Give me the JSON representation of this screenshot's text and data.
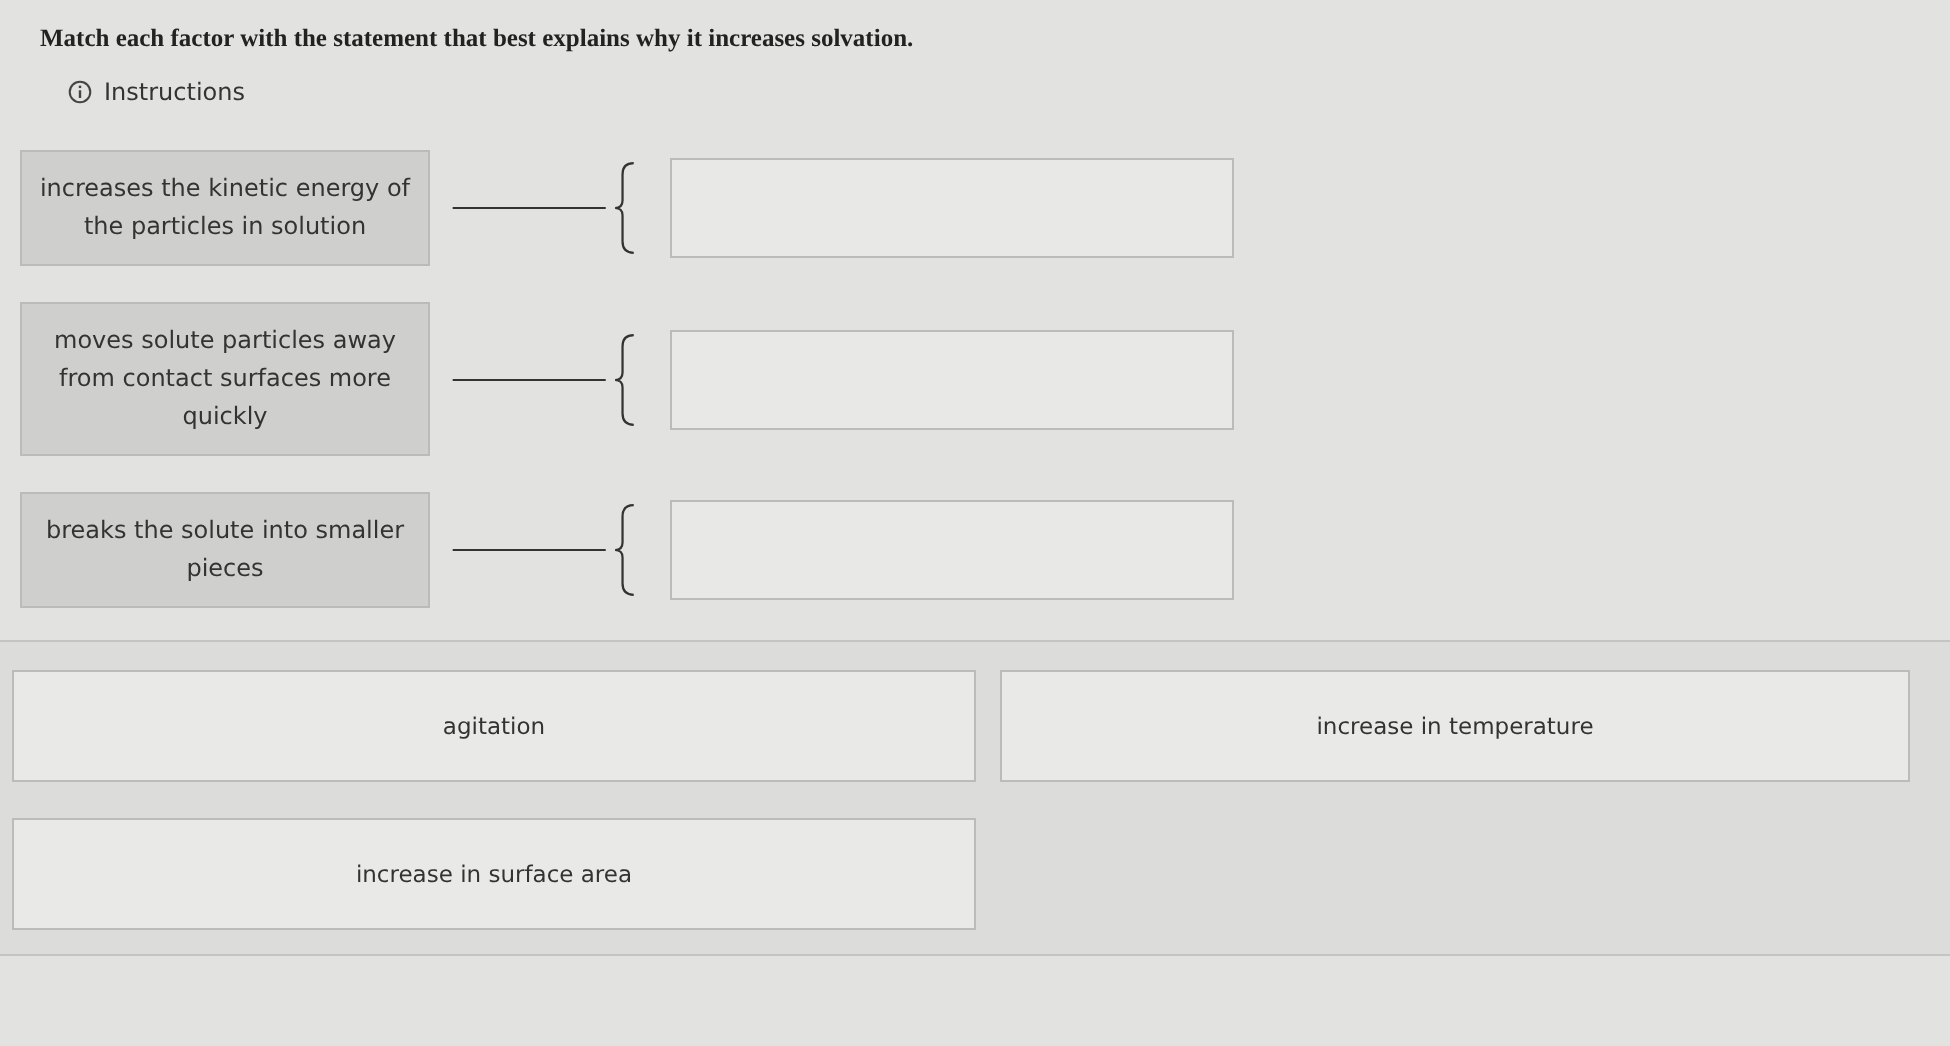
{
  "question": "Match each factor with the statement that best explains why it increases solvation.",
  "instructions": "Instructions",
  "pairs": [
    {
      "statement": "increases the kinetic energy of the particles in solution"
    },
    {
      "statement": "moves solute particles away from contact surfaces more quickly"
    },
    {
      "statement": "breaks the solute into smaller pieces"
    }
  ],
  "options": [
    "agitation",
    "increase in temperature",
    "increase in surface area"
  ]
}
